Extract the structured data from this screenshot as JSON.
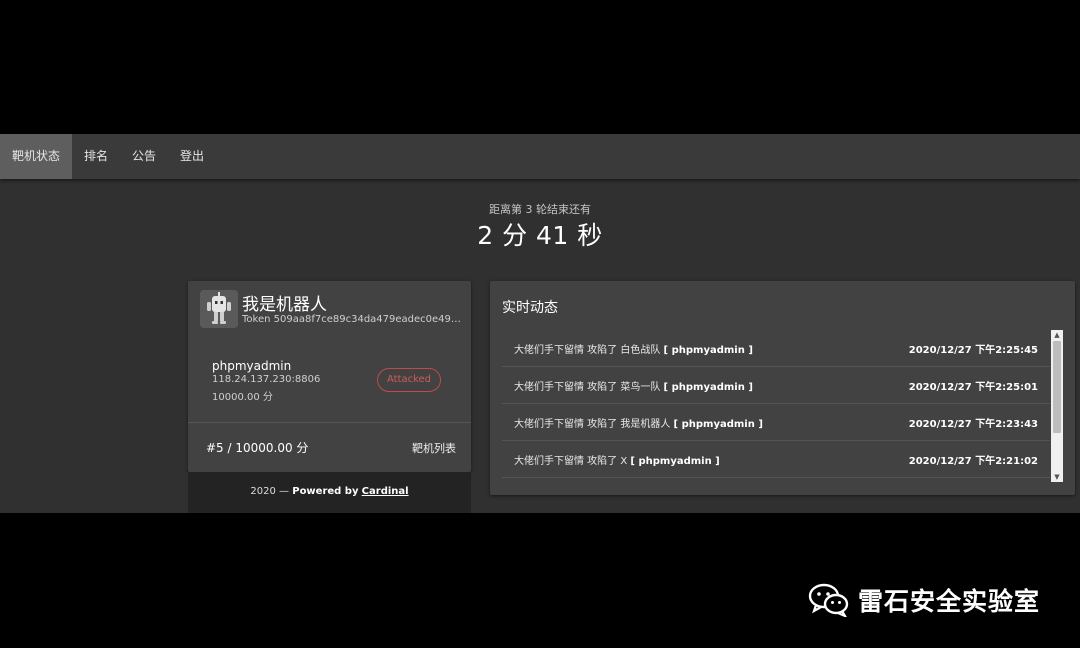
{
  "nav": {
    "items": [
      {
        "label": "靶机状态",
        "active": true
      },
      {
        "label": "排名",
        "active": false
      },
      {
        "label": "公告",
        "active": false
      },
      {
        "label": "登出",
        "active": false
      }
    ]
  },
  "countdown": {
    "label": "距离第 3 轮结束还有",
    "time": "2 分 41 秒"
  },
  "team": {
    "name": "我是机器人",
    "token": "Token 509aa8f7ce89c34da479eadec0e49c...",
    "service": {
      "name": "phpmyadmin",
      "address": "118.24.137.230:8806",
      "score": "10000.00 分",
      "status": "Attacked"
    },
    "rank_score": "#5 / 10000.00 分",
    "targets_link": "靶机列表"
  },
  "footer": {
    "year": "2020 —",
    "powered": "Powered by",
    "brand": "Cardinal"
  },
  "feed": {
    "title": "实时动态",
    "rows": [
      {
        "prefix": "大佬们手下留情 攻陷了 白色战队",
        "service": "[ phpmyadmin ]",
        "time": "2020/12/27 下午2:25:45"
      },
      {
        "prefix": "大佬们手下留情 攻陷了 菜鸟一队",
        "service": "[ phpmyadmin ]",
        "time": "2020/12/27 下午2:25:01"
      },
      {
        "prefix": "大佬们手下留情 攻陷了 我是机器人",
        "service": "[ phpmyadmin ]",
        "time": "2020/12/27 下午2:23:43"
      },
      {
        "prefix": "大佬们手下留情 攻陷了 X",
        "service": "[ phpmyadmin ]",
        "time": "2020/12/27 下午2:21:02"
      }
    ]
  },
  "watermark": {
    "text": "雷石安全实验室",
    "icon": "wechat-icon"
  },
  "colors": {
    "page_bg": "#303030",
    "card_bg": "#424242",
    "attacked": "#d05a5a"
  }
}
